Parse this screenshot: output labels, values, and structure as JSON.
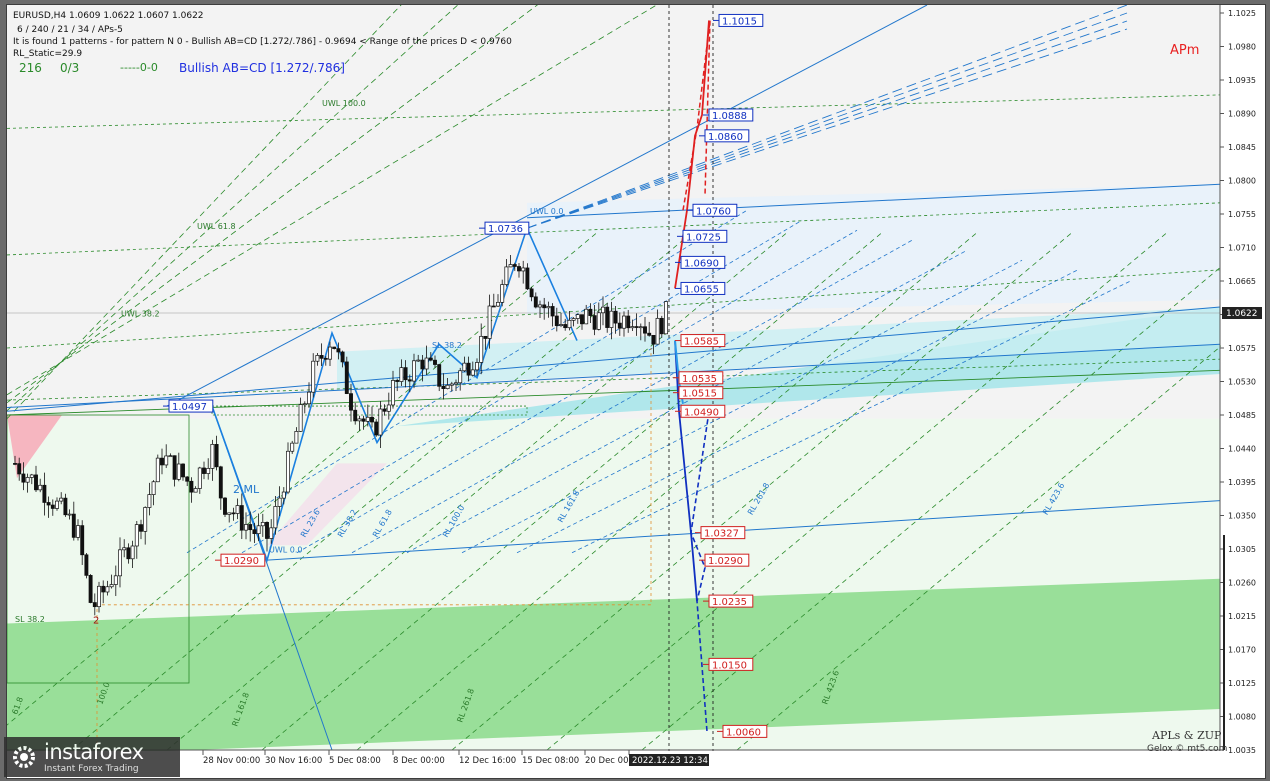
{
  "header": {
    "line1": "EURUSD,H4  1.0609 1.0622 1.0607 1.0622",
    "line2": "6 / 240 / 21 / 34 / APs-5",
    "line3": "It is found 1 patterns  -  for pattern N 0 - Bullish AB=CD [1.272/.786] - 0.9694 < Range of the prices D < 0.9760",
    "line4": "RL_Static=29.9",
    "stat_a": "216",
    "stat_b": "0/3",
    "stat_c": "-----0-0",
    "pattern_name": "Bullish AB=CD [1.272/.786]"
  },
  "apm_label": "APm",
  "signature": {
    "line1": "APLs & ZUP",
    "line2": "Gelox © mt5.com"
  },
  "logo": {
    "name": "instaforex",
    "tagline": "Instant Forex Trading"
  },
  "colors": {
    "up_target": "#e02020",
    "down_target": "#1030c0",
    "candle": "#111111",
    "fan_green": "#2a8a2a",
    "fan_blue": "#2277cc",
    "zone_cyan": "#a8e6ea",
    "zone_green": "#8fdc8f",
    "zone_pink": "#f6b6c0"
  },
  "chart_data": {
    "type": "candlestick",
    "symbol": "EURUSD",
    "timeframe": "H4",
    "ohlc_last": {
      "open": 1.0609,
      "high": 1.0622,
      "low": 1.0607,
      "close": 1.0622
    },
    "current_price": "1.0622",
    "y_ticks": [
      "1.1025",
      "1.0980",
      "1.0935",
      "1.0890",
      "1.0845",
      "1.0800",
      "1.0755",
      "1.0710",
      "1.0665",
      "1.0620",
      "1.0575",
      "1.0530",
      "1.0485",
      "1.0440",
      "1.0395",
      "1.0350",
      "1.0305",
      "1.0260",
      "1.0215",
      "1.0170",
      "1.0125",
      "1.0080",
      "1.0035"
    ],
    "x_ticks": [
      "28 Nov 00:00",
      "30 Nov 16:00",
      "5 Dec 08:00",
      "8 Dec 00:00",
      "12 Dec 16:00",
      "15 Dec 08:00",
      "20 Dec 00:00",
      "2022.12.23 12:34"
    ],
    "target_levels_up": [
      "1.1015",
      "1.0888",
      "1.0860",
      "1.0760",
      "1.0725",
      "1.0690",
      "1.0655"
    ],
    "target_levels_down": [
      "1.0585",
      "1.0535",
      "1.0515",
      "1.0490",
      "1.0327",
      "1.0290",
      "1.0235",
      "1.0150",
      "1.0060"
    ],
    "pivot_labels": [
      "1.0736",
      "1.0497",
      "1.0290"
    ],
    "fan_labels_green": [
      "UWL 100.0",
      "UWL 61.8",
      "UWL 38.2",
      "SL 38.2",
      "RL 161.8",
      "RL 261.8",
      "RL 423.6",
      "100.0",
      "61.8"
    ],
    "fan_labels_blue": [
      "UWL 0.0",
      "RL 23.6",
      "RL 38.2",
      "RL 61.8",
      "RL 100.0",
      "RL 161.8",
      "RL 261.8",
      "RL 423.6",
      "UWL 0.0",
      "SL 38.2",
      "2 ML"
    ],
    "marker_2": "2"
  }
}
